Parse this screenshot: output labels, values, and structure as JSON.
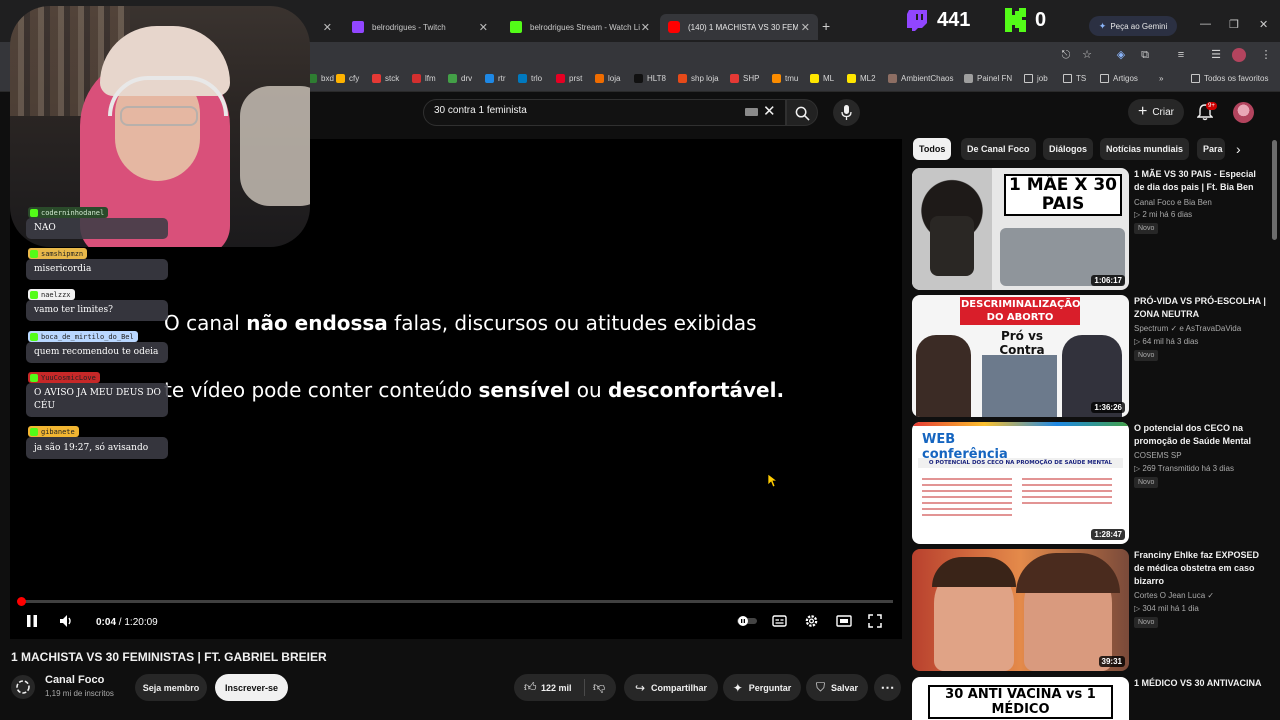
{
  "browser": {
    "tabs": [
      {
        "title": "",
        "icon_color": "#3c3c3c"
      },
      {
        "title": "belrodrigues - Twitch",
        "icon_color": "#9146ff"
      },
      {
        "title": "belrodrigues Stream - Watch Li",
        "icon_color": "#53fc18"
      },
      {
        "title": "(140) 1 MACHISTA VS 30 FEMIN",
        "icon_color": "#ff0000"
      }
    ],
    "twitch_count": "441",
    "kick_count": "0",
    "gemini_label": "Peça ao Gemini",
    "bookmarks": [
      {
        "label": "bxd",
        "color": "#2e7d32"
      },
      {
        "label": "cfy",
        "color": "#ffb300"
      },
      {
        "label": "stck",
        "color": "#e53935"
      },
      {
        "label": "lfm",
        "color": "#d32f2f"
      },
      {
        "label": "drv",
        "color": "#43a047"
      },
      {
        "label": "rtr",
        "color": "#1e88e5"
      },
      {
        "label": "trlo",
        "color": "#0079bf"
      },
      {
        "label": "prst",
        "color": "#e60023"
      },
      {
        "label": "loja",
        "color": "#ef6c00"
      },
      {
        "label": "HLT8",
        "color": "#111111"
      },
      {
        "label": "shp loja",
        "color": "#e64a19"
      },
      {
        "label": "SHP",
        "color": "#e53935"
      },
      {
        "label": "tmu",
        "color": "#fb8c00"
      },
      {
        "label": "ML",
        "color": "#ffe600"
      },
      {
        "label": "ML2",
        "color": "#ffe600"
      },
      {
        "label": "AmbientChaos",
        "color": "#8d6e63"
      },
      {
        "label": "Painel FN",
        "color": "#9e9e9e"
      },
      {
        "label": "job",
        "color": "folder"
      },
      {
        "label": "TS",
        "color": "folder"
      },
      {
        "label": "Artigos",
        "color": "folder"
      },
      {
        "label": "Todos os favoritos",
        "color": "folder"
      }
    ]
  },
  "yt": {
    "search_value": "30 contra 1 feminista",
    "create_label": "Criar",
    "notif_badge": "9+"
  },
  "player": {
    "line1": {
      "pre": "O canal ",
      "bold": "não endossa",
      "post": " falas, discursos ou atitudes exibidas"
    },
    "line2": {
      "pre": "te vídeo pode conter conteúdo ",
      "bold1": "sensível",
      "mid": " ou ",
      "bold2": "desconfortável."
    },
    "elapsed": "0:04",
    "separator": " / ",
    "duration": "1:20:09",
    "progress_fraction": 0.001
  },
  "chat": [
    {
      "user": "coderninhodanel",
      "text": "NAO",
      "name_color": "#2a4a2a",
      "text_color": "#cfe8cf"
    },
    {
      "user": "samshipmzn",
      "text": "misericordia",
      "name_color": "#e8b84a"
    },
    {
      "user": "naelzzx",
      "text": "vamo ter limites?",
      "name_color": "#f1f1f1"
    },
    {
      "user": "boca_de_mirtilo_do_Bel",
      "text": "quem recomendou te odeia",
      "name_color": "#b9d7ff"
    },
    {
      "user": "YuuCosmicLove",
      "text": "O AVISO JA MEU DEUS DO CÉU",
      "name_color": "#c62828"
    },
    {
      "user": "gibanete",
      "text": "ja são 19:27, só avisando",
      "name_color": "#f2b632"
    }
  ],
  "video": {
    "title": "1 MACHISTA VS 30 FEMINISTAS | FT. GABRIEL BREIER",
    "channel": "Canal Foco",
    "subs": "1,19 mi de inscritos",
    "join_label": "Seja membro",
    "subscribe_label": "Inscrever-se",
    "likes": "122 mil",
    "share_label": "Compartilhar",
    "ask_label": "Perguntar",
    "save_label": "Salvar"
  },
  "sidebar": {
    "chips": [
      "Todos",
      "De Canal Foco",
      "Diálogos",
      "Notícias mundiais",
      "Para"
    ],
    "recs": [
      {
        "title": "1 MÃE VS 30 PAIS - Especial de dia dos pais | Ft. Bia Ben",
        "channel": "Canal Foco e Bia Ben",
        "stats": "2 mi  há 6 dias",
        "badge": "Novo",
        "duration": "1:06:17",
        "thumb_text": "1 MÃE X 30 PAIS"
      },
      {
        "title": "PRÓ-VIDA VS PRÓ-ESCOLHA | ZONA NEUTRA",
        "channel": "Spectrum ✓ e AsTravaDaVida",
        "stats": "64 mil  há 3 dias",
        "badge": "Novo",
        "duration": "1:36:26",
        "thumb_text": "DESCRIMINALIZAÇÃO DO ABORTO",
        "thumb_sub": "Pró vs Contra"
      },
      {
        "title": "O potencial dos CECO na promoção de Saúde Mental",
        "channel": "COSEMS SP",
        "stats": "269  Transmitido há 3 dias",
        "badge": "Novo",
        "duration": "1:28:47",
        "thumb_text": "WEB conferência",
        "thumb_sub": "O POTENCIAL DOS CECO NA PROMOÇÃO DE SAÚDE MENTAL"
      },
      {
        "title": "Franciny Ehlke faz EXPOSED de médica obstetra em caso bizarro",
        "channel": "Cortes O Jean Luca ✓",
        "stats": "304 mil  há 1 dia",
        "badge": "Novo",
        "duration": "39:31",
        "thumb_text": ""
      },
      {
        "title": "1 MÉDICO VS 30 ANTIVACINA",
        "channel": "",
        "stats": "",
        "badge": "",
        "duration": "",
        "thumb_text": "30 ANTI VACINA vs 1 MÉDICO"
      }
    ]
  },
  "colors": {
    "accent": "#ff0000",
    "kick": "#53fc18",
    "twitch": "#9146ff"
  }
}
